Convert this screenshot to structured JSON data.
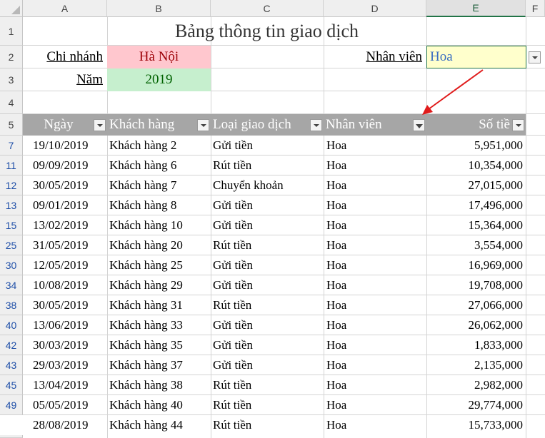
{
  "columns": [
    "A",
    "B",
    "C",
    "D",
    "E",
    "F"
  ],
  "selected_column": "E",
  "row_numbers": [
    "1",
    "2",
    "3",
    "4",
    "5",
    "7",
    "11",
    "12",
    "13",
    "15",
    "25",
    "30",
    "34",
    "38",
    "40",
    "42",
    "43",
    "45",
    "49"
  ],
  "title": "Bảng thông tin giao dịch",
  "branch_label": "Chi nhánh",
  "branch_value": "Hà Nội",
  "year_label": "Năm",
  "year_value": "2019",
  "staff_label": "Nhân viên",
  "staff_value": "Hoa",
  "table_headers": [
    "Ngày",
    "Khách hàng",
    "Loại giao dịch",
    "Nhân viên",
    "Số tiề"
  ],
  "rows": [
    [
      "19/10/2019",
      "Khách hàng 2",
      "Gửi tiền",
      "Hoa",
      "5,951,000"
    ],
    [
      "09/09/2019",
      "Khách hàng 6",
      "Rút tiền",
      "Hoa",
      "10,354,000"
    ],
    [
      "30/05/2019",
      "Khách hàng 7",
      "Chuyển khoản",
      "Hoa",
      "27,015,000"
    ],
    [
      "09/01/2019",
      "Khách hàng 8",
      "Gửi tiền",
      "Hoa",
      "17,496,000"
    ],
    [
      "13/02/2019",
      "Khách hàng 10",
      "Gửi tiền",
      "Hoa",
      "15,364,000"
    ],
    [
      "31/05/2019",
      "Khách hàng 20",
      "Rút tiền",
      "Hoa",
      "3,554,000"
    ],
    [
      "12/05/2019",
      "Khách hàng 25",
      "Gửi tiền",
      "Hoa",
      "16,969,000"
    ],
    [
      "10/08/2019",
      "Khách hàng 29",
      "Gửi tiền",
      "Hoa",
      "19,708,000"
    ],
    [
      "30/05/2019",
      "Khách hàng 31",
      "Rút tiền",
      "Hoa",
      "27,066,000"
    ],
    [
      "13/06/2019",
      "Khách hàng 33",
      "Gửi tiền",
      "Hoa",
      "26,062,000"
    ],
    [
      "30/03/2019",
      "Khách hàng 35",
      "Gửi tiền",
      "Hoa",
      "1,833,000"
    ],
    [
      "29/03/2019",
      "Khách hàng 37",
      "Gửi tiền",
      "Hoa",
      "2,135,000"
    ],
    [
      "13/04/2019",
      "Khách hàng 38",
      "Rút tiền",
      "Hoa",
      "2,982,000"
    ],
    [
      "05/05/2019",
      "Khách hàng 40",
      "Rút tiền",
      "Hoa",
      "29,774,000"
    ],
    [
      "28/08/2019",
      "Khách hàng 44",
      "Rút tiền",
      "Hoa",
      "15,733,000"
    ]
  ],
  "colors": {
    "pink_fill": "#ffc7ce",
    "pink_text": "#9c0006",
    "green_fill": "#c6efce",
    "green_text": "#006100",
    "input_fill": "#ffffcc",
    "header_fill": "#a6a6a6",
    "arrow": "#e01b1b",
    "filtered_row_number": "#1f4fa8"
  },
  "icons": [
    "dropdown-arrow-icon",
    "filter-funnel-icon",
    "annotation-arrow-icon"
  ]
}
